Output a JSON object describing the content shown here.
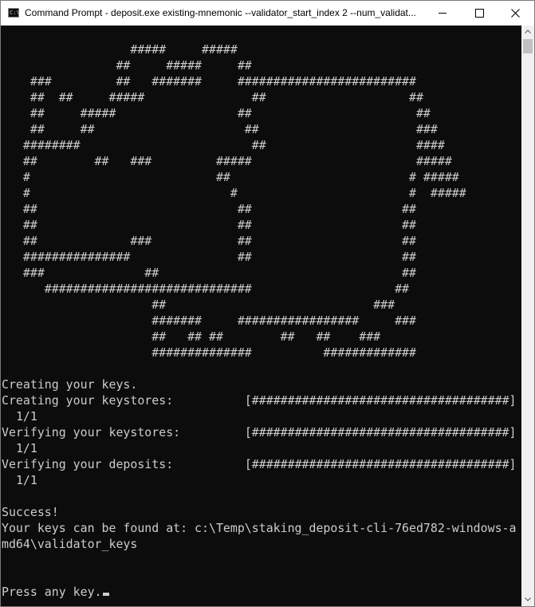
{
  "window": {
    "title": "Command Prompt - deposit.exe  existing-mnemonic --validator_start_index 2 --num_validat...",
    "icon_label": "C:\\"
  },
  "controls": {
    "minimize": "minimize-icon",
    "maximize": "maximize-icon",
    "close": "close-icon"
  },
  "console": {
    "ascii_art": [
      "                  #####     #####",
      "                ##     #####     ##",
      "    ###         ##   #######     #########################",
      "    ##  ##     #####               ##                    ##",
      "    ##     #####                 ##                       ##",
      "    ##     ##                     ##                      ###",
      "   ########                        ##                     ####",
      "   ##        ##   ###         #####                       #####",
      "   #                          ##                         # #####",
      "   #                            #                        #  #####",
      "   ##                            ##                     ##",
      "   ##                            ##                     ##",
      "   ##             ###            ##                     ##",
      "   ###############               ##                     ##",
      "   ###              ##                                  ##",
      "      #############################                    ##",
      "                     ##                             ###",
      "                     #######     #################     ###",
      "                     ##   ## ##        ##   ##    ###",
      "                     ##############          #############"
    ],
    "creating_keys": "Creating your keys.",
    "progress": [
      {
        "label": "Creating your keystores:",
        "bar": "[####################################]",
        "count": "1/1"
      },
      {
        "label": "Verifying your keystores:",
        "bar": "[####################################]",
        "count": "1/1"
      },
      {
        "label": "Verifying your deposits:",
        "bar": "[####################################]",
        "count": "1/1"
      }
    ],
    "success": "Success!",
    "keys_location_1": "Your keys can be found at: c:\\Temp\\staking_deposit-cli-76ed782-windows-a",
    "keys_location_2": "md64\\validator_keys",
    "prompt": "Press any key."
  }
}
